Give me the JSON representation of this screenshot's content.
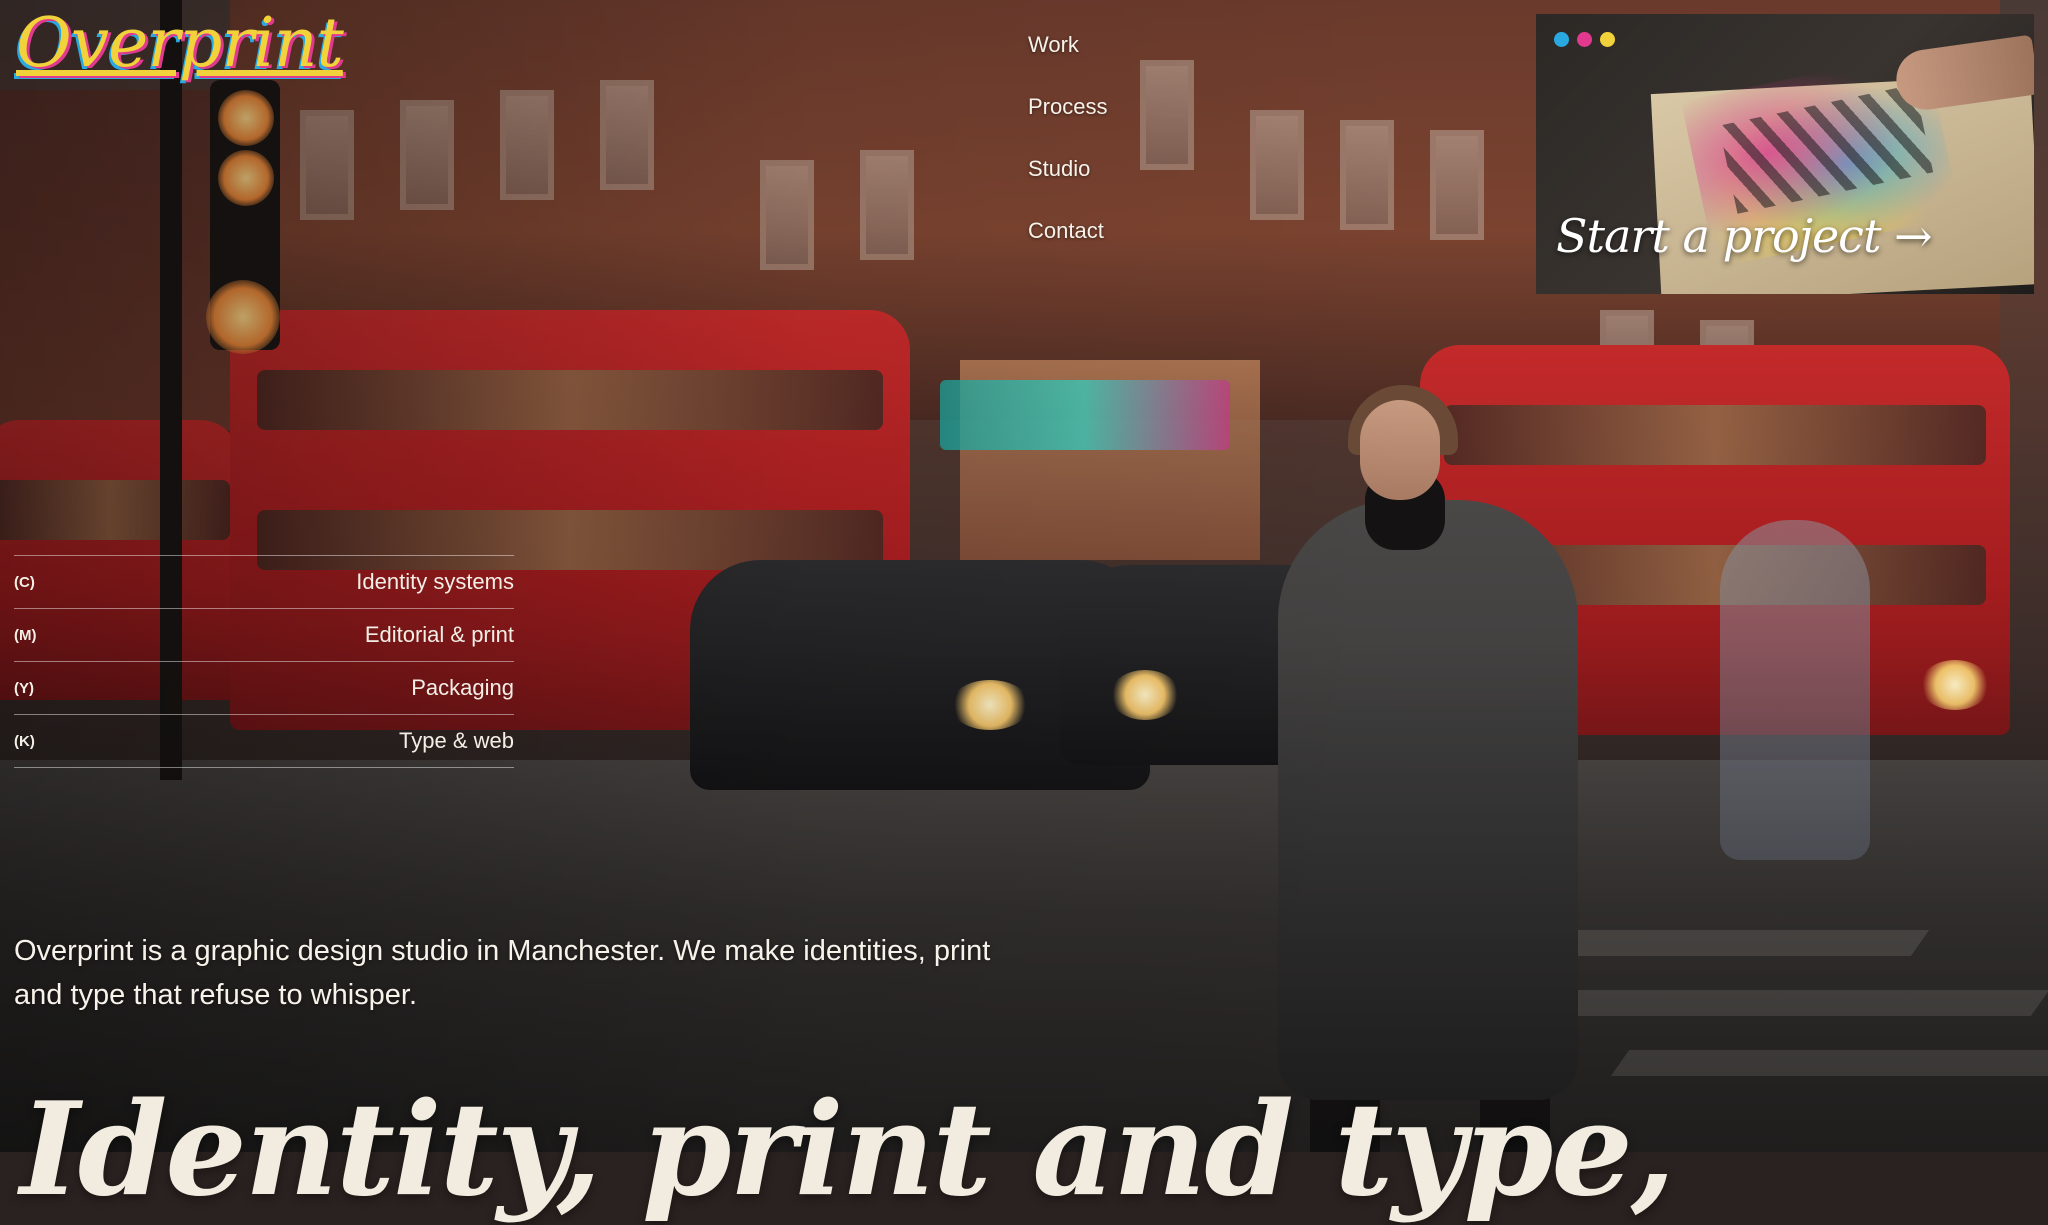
{
  "brand": {
    "logo_text": "Overprint",
    "colors": {
      "cyan": "#2aa9e0",
      "magenta": "#e0398e",
      "yellow": "#f2d23a"
    }
  },
  "nav": {
    "items": [
      {
        "label": "Work"
      },
      {
        "label": "Process"
      },
      {
        "label": "Studio"
      },
      {
        "label": "Contact"
      }
    ]
  },
  "cta": {
    "label": "Start a project →",
    "dots": [
      "#2aa9e0",
      "#e0398e",
      "#f2d23a"
    ]
  },
  "services": {
    "items": [
      {
        "code": "(C)",
        "name": "Identity systems"
      },
      {
        "code": "(M)",
        "name": "Editorial & print"
      },
      {
        "code": "(Y)",
        "name": "Packaging"
      },
      {
        "code": "(K)",
        "name": "Type & web"
      }
    ]
  },
  "intro": {
    "text": "Overprint is a graphic design studio in Manchester. We make identities, print and type that refuse to whisper."
  },
  "hero": {
    "title": "Identity, print and type,"
  }
}
